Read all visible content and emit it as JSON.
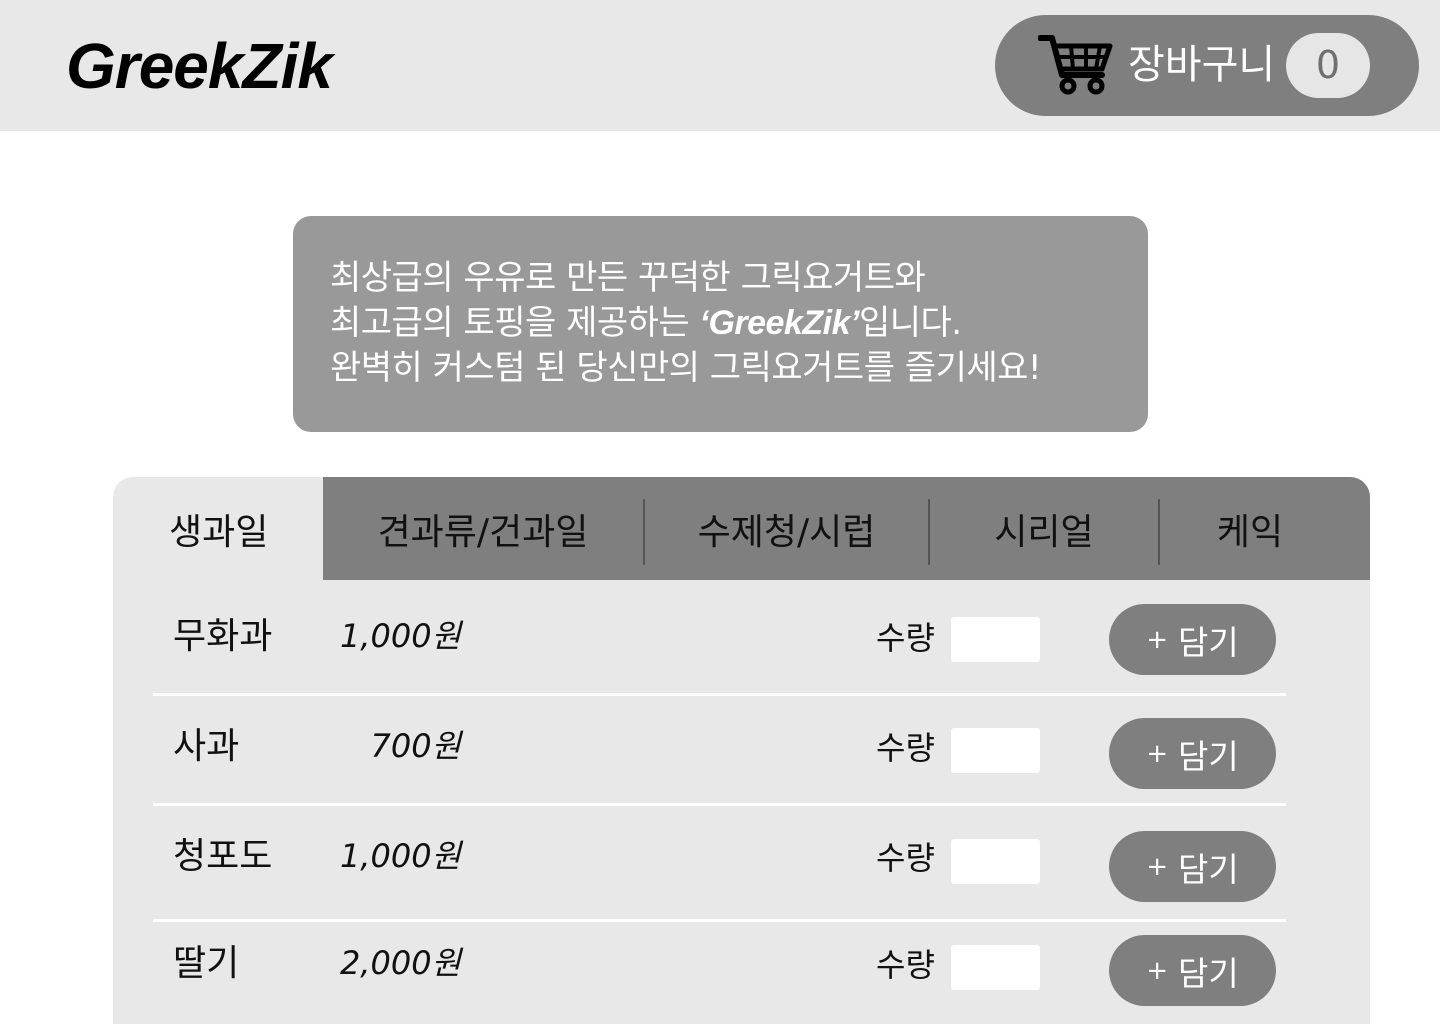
{
  "header": {
    "logo": "GreekZik",
    "cart_label": "장바구니",
    "cart_count": "0"
  },
  "intro": {
    "line1": "최상급의 우유로 만든 꾸덕한 그릭요거트와",
    "line2_before": "최고급의 토핑을 제공하는 ",
    "line2_brand": "‘GreekZik’",
    "line2_after": "입니다.",
    "line3": "완벽히 커스텀 된 당신만의 그릭요거트를 즐기세요!"
  },
  "tabs": [
    {
      "label": "생과일",
      "active": true
    },
    {
      "label": "견과류/건과일",
      "active": false
    },
    {
      "label": "수제청/시럽",
      "active": false
    },
    {
      "label": "시리얼",
      "active": false
    },
    {
      "label": "케익",
      "active": false
    }
  ],
  "products": [
    {
      "name": "무화과",
      "price": "1,000원",
      "qty_label": "수량",
      "qty_value": "",
      "add_label": "담기"
    },
    {
      "name": "사과",
      "price": "700원",
      "qty_label": "수량",
      "qty_value": "",
      "add_label": "담기"
    },
    {
      "name": "청포도",
      "price": "1,000원",
      "qty_label": "수량",
      "qty_value": "",
      "add_label": "담기"
    },
    {
      "name": "딸기",
      "price": "2,000원",
      "qty_label": "수량",
      "qty_value": "",
      "add_label": "담기"
    }
  ],
  "icons": {
    "cart": "shopping-cart-icon",
    "plus": "plus-icon"
  },
  "colors": {
    "header_bg": "#e8e8e8",
    "accent_gray": "#7f7f7f",
    "intro_bg": "#999999",
    "panel_bg": "#e8e8e8"
  }
}
